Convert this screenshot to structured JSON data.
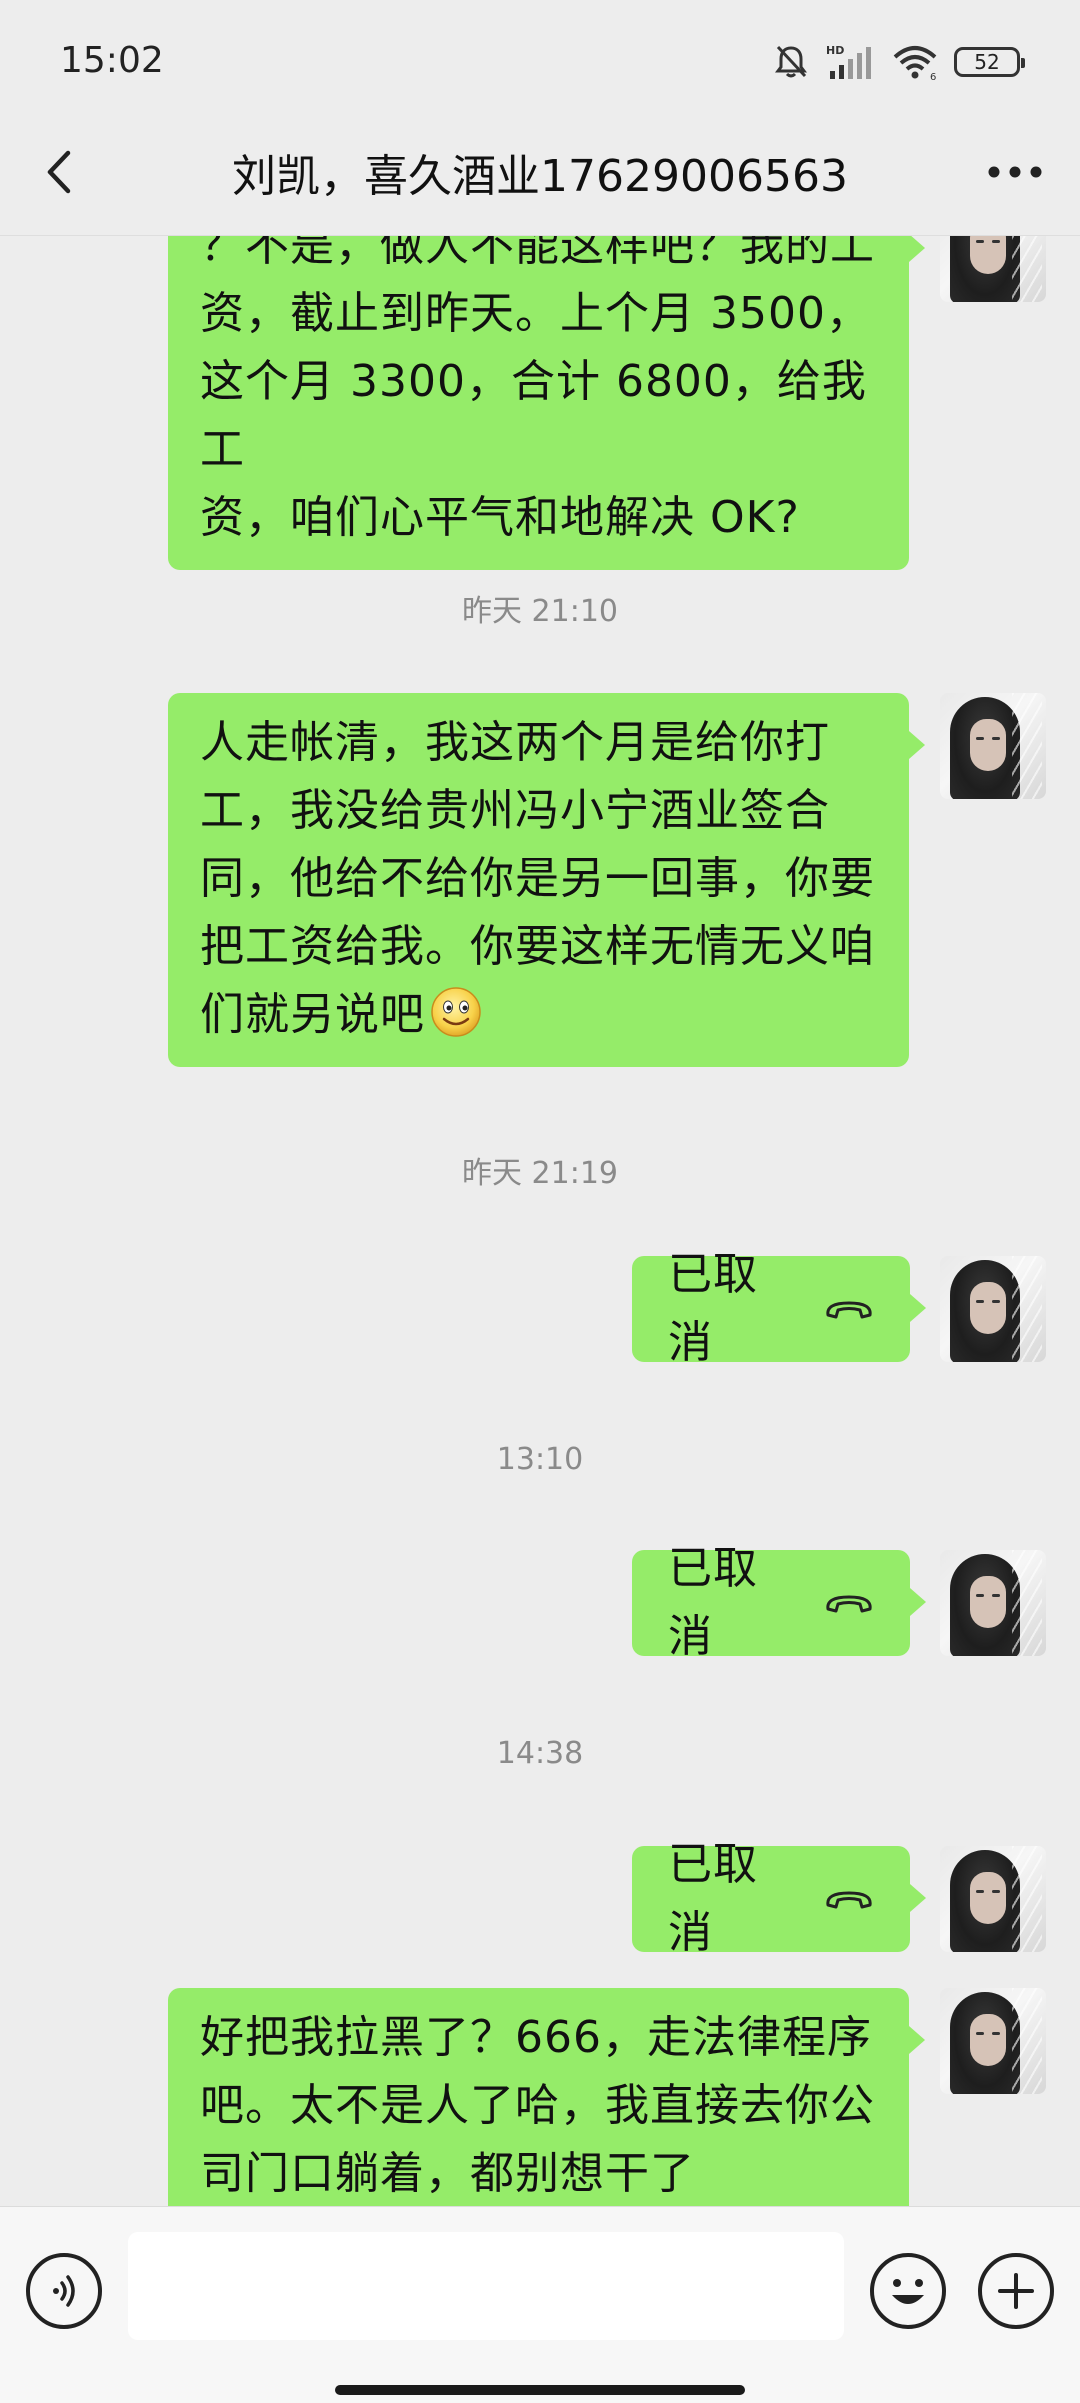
{
  "status_bar": {
    "time": "15:02",
    "battery": "52",
    "icons": [
      "bell-muted-icon",
      "hd-signal-icon",
      "wifi-icon",
      "battery-icon"
    ]
  },
  "header": {
    "title": "刘凯，喜久酒业17629006563",
    "back_icon": "chevron-left-icon",
    "more_icon": "more-dots-icon"
  },
  "messages": [
    {
      "type": "text",
      "sender": "me",
      "lines": [
        "？不是，做人不能这样吧？我的工",
        "资，截止到昨天。上个月 3500，",
        "这个月 3300，合计 6800，给我工",
        "资，咱们心平气和地解决 OK?"
      ]
    },
    {
      "type": "time",
      "text": "昨天 21:10"
    },
    {
      "type": "text",
      "sender": "me",
      "lines": [
        "人走帐清，我这两个月是给你打",
        "工，我没给贵州冯小宁酒业签合",
        "同，他给不给你是另一回事，你要",
        "把工资给我。你要这样无情无义咱",
        "们就另说吧"
      ],
      "trailing_emoji": "smile-emoji"
    },
    {
      "type": "time",
      "text": "昨天 21:19"
    },
    {
      "type": "call",
      "sender": "me",
      "label": "已取消",
      "icon": "phone-hangup-icon"
    },
    {
      "type": "time",
      "text": "13:10"
    },
    {
      "type": "call",
      "sender": "me",
      "label": "已取消",
      "icon": "phone-hangup-icon"
    },
    {
      "type": "time",
      "text": "14:38"
    },
    {
      "type": "call",
      "sender": "me",
      "label": "已取消",
      "icon": "phone-hangup-icon"
    },
    {
      "type": "text",
      "sender": "me",
      "lines": [
        "好把我拉黑了？666，走法律程序",
        "吧。太不是人了哈，我直接去你公",
        "司门口躺着，都别想干了"
      ]
    }
  ],
  "input_bar": {
    "placeholder": "",
    "voice_icon": "voice-icon",
    "emoji_icon": "emoji-icon",
    "plus_icon": "plus-icon"
  },
  "colors": {
    "bubble_green": "#95ec69",
    "background": "#ededed",
    "timestamp": "#8a8a8a"
  }
}
